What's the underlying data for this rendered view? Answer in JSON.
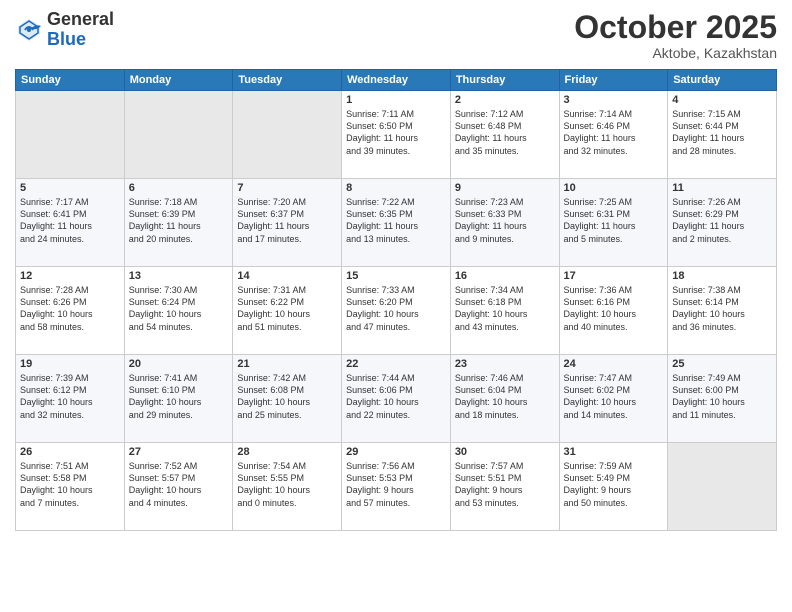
{
  "header": {
    "logo_general": "General",
    "logo_blue": "Blue",
    "month": "October 2025",
    "location": "Aktobe, Kazakhstan"
  },
  "columns": [
    "Sunday",
    "Monday",
    "Tuesday",
    "Wednesday",
    "Thursday",
    "Friday",
    "Saturday"
  ],
  "weeks": [
    {
      "days": [
        {
          "num": "",
          "info": ""
        },
        {
          "num": "",
          "info": ""
        },
        {
          "num": "",
          "info": ""
        },
        {
          "num": "1",
          "info": "Sunrise: 7:11 AM\nSunset: 6:50 PM\nDaylight: 11 hours\nand 39 minutes."
        },
        {
          "num": "2",
          "info": "Sunrise: 7:12 AM\nSunset: 6:48 PM\nDaylight: 11 hours\nand 35 minutes."
        },
        {
          "num": "3",
          "info": "Sunrise: 7:14 AM\nSunset: 6:46 PM\nDaylight: 11 hours\nand 32 minutes."
        },
        {
          "num": "4",
          "info": "Sunrise: 7:15 AM\nSunset: 6:44 PM\nDaylight: 11 hours\nand 28 minutes."
        }
      ]
    },
    {
      "days": [
        {
          "num": "5",
          "info": "Sunrise: 7:17 AM\nSunset: 6:41 PM\nDaylight: 11 hours\nand 24 minutes."
        },
        {
          "num": "6",
          "info": "Sunrise: 7:18 AM\nSunset: 6:39 PM\nDaylight: 11 hours\nand 20 minutes."
        },
        {
          "num": "7",
          "info": "Sunrise: 7:20 AM\nSunset: 6:37 PM\nDaylight: 11 hours\nand 17 minutes."
        },
        {
          "num": "8",
          "info": "Sunrise: 7:22 AM\nSunset: 6:35 PM\nDaylight: 11 hours\nand 13 minutes."
        },
        {
          "num": "9",
          "info": "Sunrise: 7:23 AM\nSunset: 6:33 PM\nDaylight: 11 hours\nand 9 minutes."
        },
        {
          "num": "10",
          "info": "Sunrise: 7:25 AM\nSunset: 6:31 PM\nDaylight: 11 hours\nand 5 minutes."
        },
        {
          "num": "11",
          "info": "Sunrise: 7:26 AM\nSunset: 6:29 PM\nDaylight: 11 hours\nand 2 minutes."
        }
      ]
    },
    {
      "days": [
        {
          "num": "12",
          "info": "Sunrise: 7:28 AM\nSunset: 6:26 PM\nDaylight: 10 hours\nand 58 minutes."
        },
        {
          "num": "13",
          "info": "Sunrise: 7:30 AM\nSunset: 6:24 PM\nDaylight: 10 hours\nand 54 minutes."
        },
        {
          "num": "14",
          "info": "Sunrise: 7:31 AM\nSunset: 6:22 PM\nDaylight: 10 hours\nand 51 minutes."
        },
        {
          "num": "15",
          "info": "Sunrise: 7:33 AM\nSunset: 6:20 PM\nDaylight: 10 hours\nand 47 minutes."
        },
        {
          "num": "16",
          "info": "Sunrise: 7:34 AM\nSunset: 6:18 PM\nDaylight: 10 hours\nand 43 minutes."
        },
        {
          "num": "17",
          "info": "Sunrise: 7:36 AM\nSunset: 6:16 PM\nDaylight: 10 hours\nand 40 minutes."
        },
        {
          "num": "18",
          "info": "Sunrise: 7:38 AM\nSunset: 6:14 PM\nDaylight: 10 hours\nand 36 minutes."
        }
      ]
    },
    {
      "days": [
        {
          "num": "19",
          "info": "Sunrise: 7:39 AM\nSunset: 6:12 PM\nDaylight: 10 hours\nand 32 minutes."
        },
        {
          "num": "20",
          "info": "Sunrise: 7:41 AM\nSunset: 6:10 PM\nDaylight: 10 hours\nand 29 minutes."
        },
        {
          "num": "21",
          "info": "Sunrise: 7:42 AM\nSunset: 6:08 PM\nDaylight: 10 hours\nand 25 minutes."
        },
        {
          "num": "22",
          "info": "Sunrise: 7:44 AM\nSunset: 6:06 PM\nDaylight: 10 hours\nand 22 minutes."
        },
        {
          "num": "23",
          "info": "Sunrise: 7:46 AM\nSunset: 6:04 PM\nDaylight: 10 hours\nand 18 minutes."
        },
        {
          "num": "24",
          "info": "Sunrise: 7:47 AM\nSunset: 6:02 PM\nDaylight: 10 hours\nand 14 minutes."
        },
        {
          "num": "25",
          "info": "Sunrise: 7:49 AM\nSunset: 6:00 PM\nDaylight: 10 hours\nand 11 minutes."
        }
      ]
    },
    {
      "days": [
        {
          "num": "26",
          "info": "Sunrise: 7:51 AM\nSunset: 5:58 PM\nDaylight: 10 hours\nand 7 minutes."
        },
        {
          "num": "27",
          "info": "Sunrise: 7:52 AM\nSunset: 5:57 PM\nDaylight: 10 hours\nand 4 minutes."
        },
        {
          "num": "28",
          "info": "Sunrise: 7:54 AM\nSunset: 5:55 PM\nDaylight: 10 hours\nand 0 minutes."
        },
        {
          "num": "29",
          "info": "Sunrise: 7:56 AM\nSunset: 5:53 PM\nDaylight: 9 hours\nand 57 minutes."
        },
        {
          "num": "30",
          "info": "Sunrise: 7:57 AM\nSunset: 5:51 PM\nDaylight: 9 hours\nand 53 minutes."
        },
        {
          "num": "31",
          "info": "Sunrise: 7:59 AM\nSunset: 5:49 PM\nDaylight: 9 hours\nand 50 minutes."
        },
        {
          "num": "",
          "info": ""
        }
      ]
    }
  ]
}
